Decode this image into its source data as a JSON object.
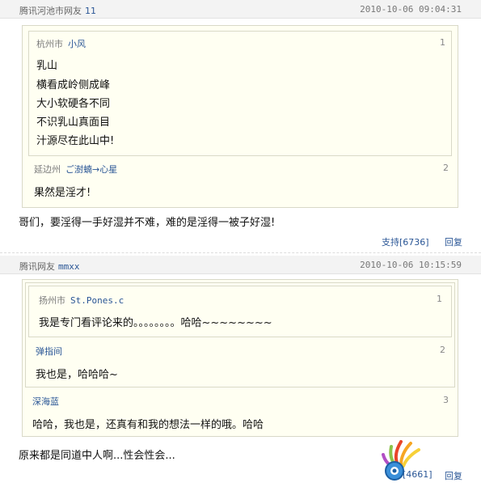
{
  "comments": [
    {
      "source": "腾讯河池市网友",
      "nick": "11",
      "time": "2010-10-06 09:04:31",
      "quotes": [
        {
          "location": "杭州市",
          "nick": "小风",
          "num": "1",
          "lines": [
            "乳山",
            "横看成岭侧成峰",
            "大小软硬各不同",
            "不识乳山真面目",
            "汁源尽在此山中!"
          ]
        },
        {
          "location": "延边州",
          "nick": "ご澍蝻→心星",
          "num": "2",
          "lines": [
            "果然是淫才!"
          ]
        }
      ],
      "text": "哥们，要淫得一手好湿并不难，难的是淫得一被子好湿!",
      "support_label": "支持[6736]",
      "reply_label": "回复"
    },
    {
      "source": "腾讯网友",
      "nick": "mmxx",
      "time": "2010-10-06 10:15:59",
      "quotes": [
        {
          "location": "扬州市",
          "nick": "St.Pones.c",
          "num": "1",
          "lines": [
            "我是专门看评论来的。。。。。。。。哈哈~~~~~~~~"
          ]
        },
        {
          "location": "",
          "nick": "弹指间",
          "num": "2",
          "lines": [
            "我也是，哈哈哈~"
          ]
        },
        {
          "location": "",
          "nick": "深海蓝",
          "num": "3",
          "lines": [
            "哈哈，我也是，还真有和我的想法一样的哦。哈哈"
          ]
        }
      ],
      "text": "原来都是同道中人啊...性会性会...",
      "support_label": "[4661]",
      "reply_label": "回复"
    }
  ],
  "colors": {
    "link": "#2a5696",
    "quote_bg": "#fffff2",
    "header_bg": "#f3f3f3"
  },
  "icons": {
    "watermark": "colorful-logo-icon"
  }
}
